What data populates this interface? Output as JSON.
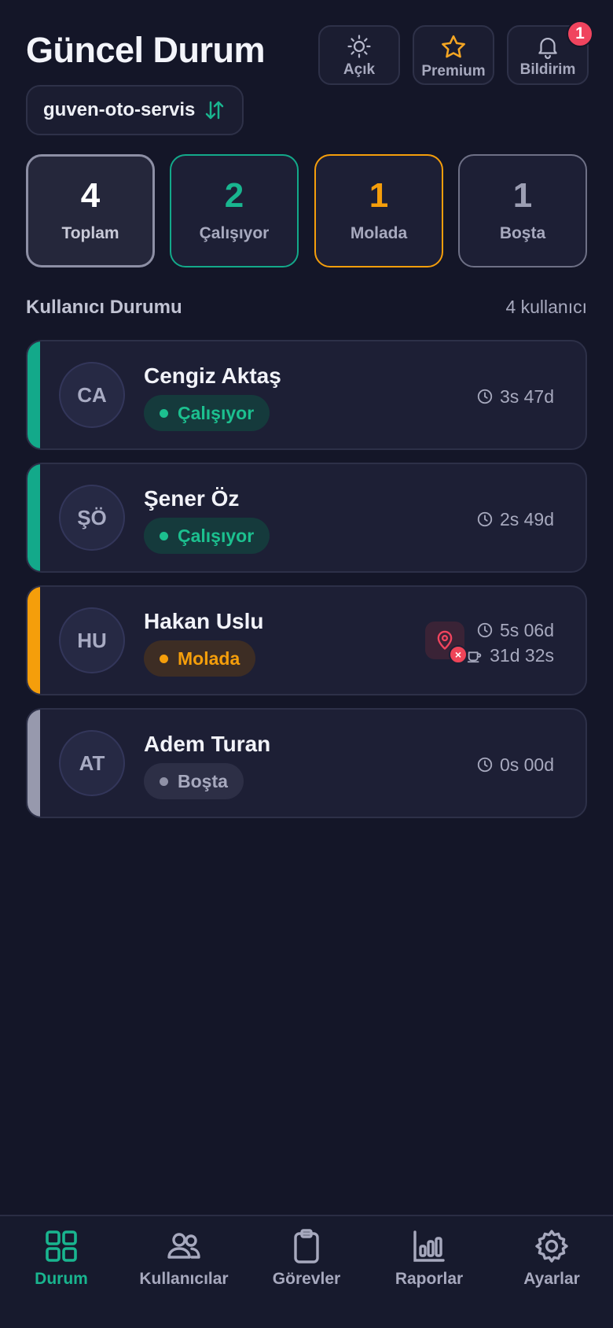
{
  "header": {
    "title": "Güncel Durum",
    "buttons": [
      {
        "label": "Açık",
        "icon": "sun-icon"
      },
      {
        "label": "Premium",
        "icon": "star-icon"
      },
      {
        "label": "Bildirim",
        "icon": "bell-icon",
        "badge": "1"
      }
    ]
  },
  "org": {
    "name": "guven-oto-servis",
    "icon": "swap-icon"
  },
  "stats": [
    {
      "value": "4",
      "label": "Toplam",
      "color": "#ffffff"
    },
    {
      "value": "2",
      "label": "Çalışıyor",
      "color": "#19b58f"
    },
    {
      "value": "1",
      "label": "Molada",
      "color": "#f59e0b"
    },
    {
      "value": "1",
      "label": "Boşta",
      "color": "#9c9eb3"
    }
  ],
  "section": {
    "title": "Kullanıcı Durumu",
    "count": "4 kullanıcı"
  },
  "users": [
    {
      "initials": "CA",
      "name": "Cengiz Aktaş",
      "status": "Çalışıyor",
      "time": "3s 47d",
      "accent": "#13a98a"
    },
    {
      "initials": "ŞÖ",
      "name": "Şener Öz",
      "status": "Çalışıyor",
      "time": "2s 49d",
      "accent": "#13a98a"
    },
    {
      "initials": "HU",
      "name": "Hakan Uslu",
      "status": "Molada",
      "time": "5s 06d",
      "break_time": "31d 32s",
      "location_alert": "×",
      "accent": "#f59e0b"
    },
    {
      "initials": "AT",
      "name": "Adem Turan",
      "status": "Boşta",
      "time": "0s 00d",
      "accent": "#9799ad"
    }
  ],
  "tabs": [
    {
      "label": "Durum",
      "icon": "grid-icon",
      "active": true
    },
    {
      "label": "Kullanıcılar",
      "icon": "users-icon"
    },
    {
      "label": "Görevler",
      "icon": "clipboard-icon"
    },
    {
      "label": "Raporlar",
      "icon": "bar-chart-icon"
    },
    {
      "label": "Ayarlar",
      "icon": "gear-icon"
    }
  ],
  "colors": {
    "accent": "#19b58f",
    "warning": "#f59e0b",
    "danger": "#f0445e",
    "background": "#141628"
  }
}
